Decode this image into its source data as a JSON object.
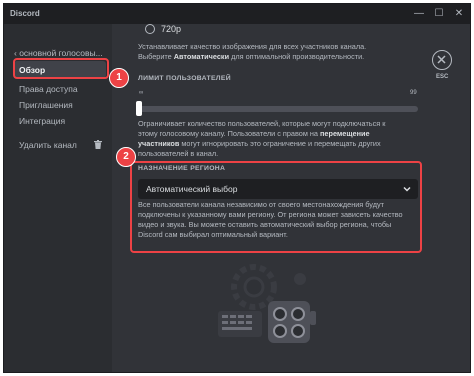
{
  "window": {
    "title": "Discord",
    "minimize_glyph": "—",
    "maximize_glyph": "☐",
    "close_glyph": "✕"
  },
  "sidebar": {
    "back_label": "‹ основной голосовы...",
    "items": [
      {
        "label": "Обзор",
        "active": true
      },
      {
        "label": "Права доступа"
      },
      {
        "label": "Приглашения"
      },
      {
        "label": "Интеграция"
      },
      {
        "label": "Удалить канал"
      }
    ],
    "delete_icon": "trash-icon"
  },
  "main": {
    "video_quality": {
      "option_label": "720p",
      "desc_part1": "Устанавливает качество изображения для всех участников канала. Выберите ",
      "desc_bold": "Автоматически",
      "desc_part2": " для оптимальной производительности."
    },
    "user_limit": {
      "label": "ЛИМИТ ПОЛЬЗОВАТЕЛЕЙ",
      "tick_min": "∞",
      "tick_max": "99",
      "value": "∞",
      "desc_part1": "Ограничивает количество пользователей, которые могут подключаться к этому голосовому каналу. Пользователи с правом на ",
      "desc_bold": "перемещение участников",
      "desc_part2": " могут игнорировать это ограничение и перемещать других пользователей в канал."
    },
    "region": {
      "label": "НАЗНАЧЕНИЕ РЕГИОНА",
      "selected": "Автоматический выбор",
      "desc": "Все пользователи канала независимо от своего местонахождения будут подключены к указанному вами региону. От региона может зависеть качество видео и звука. Вы можете оставить автоматический выбор региона, чтобы Discord сам выбирал оптимальный вариант."
    },
    "close": {
      "label": "ESC"
    }
  },
  "annotations": {
    "badge1": "1",
    "badge2": "2",
    "color": "#ed4245"
  }
}
